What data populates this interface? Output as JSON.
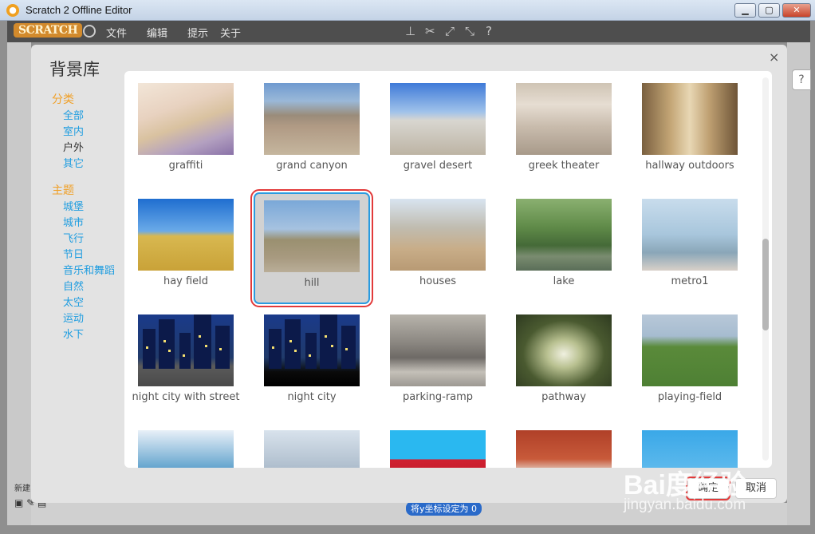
{
  "window": {
    "title": "Scratch 2 Offline Editor",
    "minimize": "▁",
    "maximize": "▢",
    "close": "✕"
  },
  "menubar": {
    "logo": "SCRATCH",
    "items": [
      "文件",
      "编辑",
      "提示",
      "关于"
    ]
  },
  "dialog": {
    "title": "背景库",
    "close": "×",
    "ok_label": "确定",
    "cancel_label": "取消"
  },
  "sidebar": {
    "category_heading": "分类",
    "categories": [
      "全部",
      "室内",
      "户外",
      "其它"
    ],
    "active_category": "户外",
    "theme_heading": "主题",
    "themes": [
      "城堡",
      "城市",
      "飞行",
      "节日",
      "音乐和舞蹈",
      "自然",
      "太空",
      "运动",
      "水下"
    ]
  },
  "library": {
    "selected": "hill",
    "items": [
      "graffiti",
      "grand canyon",
      "gravel desert",
      "greek theater",
      "hallway outdoors",
      "hay field",
      "hill",
      "houses",
      "lake",
      "metro1",
      "night city with street",
      "night city",
      "parking-ramp",
      "pathway",
      "playing-field"
    ]
  },
  "background_editor": {
    "new_sprite_label": "新建",
    "block_label": "将y坐标设定为",
    "block_value": "0"
  },
  "watermark": {
    "logo": "Bai度经验",
    "url": "jingyan.baidu.com"
  },
  "colors": {
    "accent_orange": "#f0a028",
    "link_blue": "#1f9de0",
    "selection_blue": "#2a9be0",
    "highlight_red": "#e23a3a"
  }
}
